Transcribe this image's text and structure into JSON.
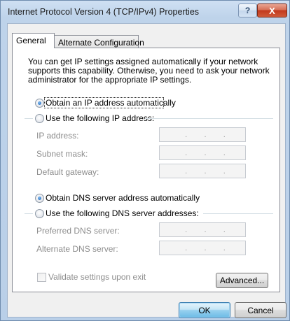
{
  "window": {
    "title": "Internet Protocol Version 4 (TCP/IPv4) Properties",
    "help_glyph": "?",
    "close_glyph": "X"
  },
  "tabs": [
    {
      "label": "General",
      "active": true
    },
    {
      "label": "Alternate Configuration",
      "active": false
    }
  ],
  "general": {
    "description": "You can get IP settings assigned automatically if your network supports this capability. Otherwise, you need to ask your network administrator for the appropriate IP settings.",
    "ip_radio_auto": {
      "label": "Obtain an IP address automatically",
      "selected": true
    },
    "ip_radio_manual": {
      "label": "Use the following IP address:",
      "selected": false
    },
    "ip_fields": [
      {
        "label": "IP address:",
        "value": ". . ."
      },
      {
        "label": "Subnet mask:",
        "value": ". . ."
      },
      {
        "label": "Default gateway:",
        "value": ". . ."
      }
    ],
    "dns_radio_auto": {
      "label": "Obtain DNS server address automatically",
      "selected": true
    },
    "dns_radio_manual": {
      "label": "Use the following DNS server addresses:",
      "selected": false
    },
    "dns_fields": [
      {
        "label": "Preferred DNS server:",
        "value": ". . ."
      },
      {
        "label": "Alternate DNS server:",
        "value": ". . ."
      }
    ],
    "validate_checkbox": {
      "label": "Validate settings upon exit",
      "checked": false
    },
    "advanced_button": "Advanced..."
  },
  "footer": {
    "ok_button": "OK",
    "cancel_button": "Cancel"
  },
  "colors": {
    "title_bar": "#bed3ea",
    "close_button": "#c2391d",
    "ok_button": "#98d1ef",
    "selected_radio": "#1d5fb4"
  }
}
